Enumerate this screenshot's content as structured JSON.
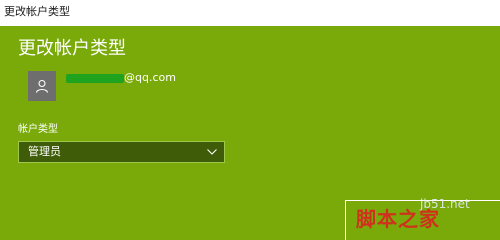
{
  "window": {
    "title": "更改帐户类型"
  },
  "page": {
    "heading": "更改帐户类型"
  },
  "account": {
    "email_domain": "@qq.com"
  },
  "account_type": {
    "label": "帐户类型",
    "selected": "管理员"
  },
  "watermark": {
    "site": "jb51.net",
    "brand": "脚本之家"
  },
  "icons": {
    "avatar": "user-icon",
    "dropdown": "chevron-down-icon"
  },
  "colors": {
    "background": "#7aaa0a",
    "select_bg": "#3f5c08"
  }
}
